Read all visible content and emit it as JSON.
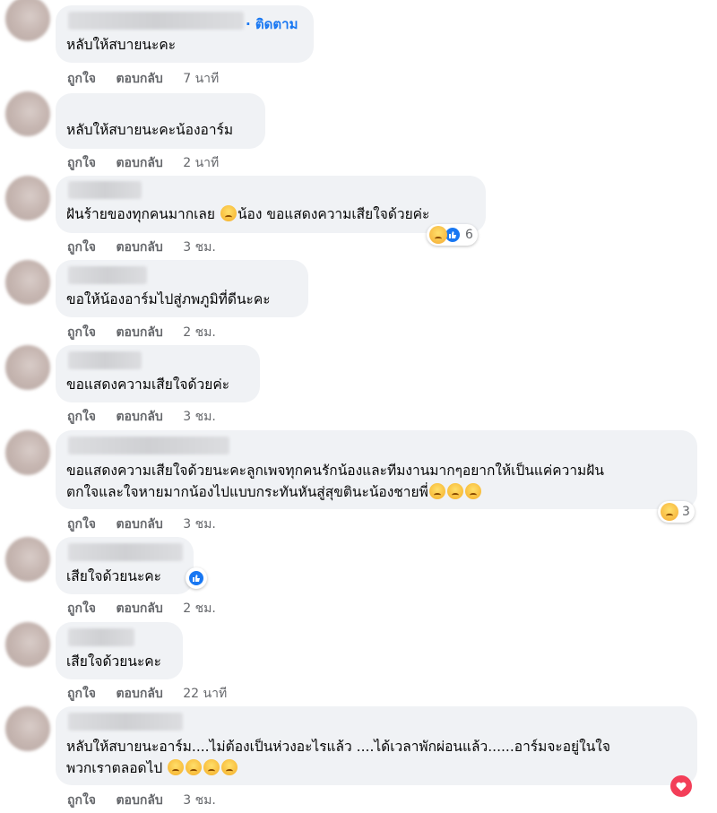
{
  "comments": [
    {
      "follow": "· ติดตาม",
      "text": [
        "หลับให้สบายนะคะ"
      ],
      "like": "ถูกใจ",
      "reply": "ตอบกลับ",
      "time": "7 นาที"
    },
    {
      "text": [
        "หลับให้สบายนะคะน้องอาร์ม"
      ],
      "like": "ถูกใจ",
      "reply": "ตอบกลับ",
      "time": "2 นาที"
    },
    {
      "text_before_emoji": "ฝันร้ายของทุกคนมากเลย",
      "text_after_emoji": "น้อง ขอแสดงความเสียใจด้วยค่ะ",
      "like": "ถูกใจ",
      "reply": "ตอบกลับ",
      "time": "3 ชม.",
      "reaction_count": "6"
    },
    {
      "text": [
        "ขอให้น้องอาร์มไปสู่ภพภูมิที่ดีนะคะ"
      ],
      "like": "ถูกใจ",
      "reply": "ตอบกลับ",
      "time": "2 ชม."
    },
    {
      "text": [
        "ขอแสดงความเสียใจด้วยค่ะ"
      ],
      "like": "ถูกใจ",
      "reply": "ตอบกลับ",
      "time": "3 ชม."
    },
    {
      "text": [
        "ขอแสดงความเสียใจด้วยนะคะลูกเพจทุกคนรักน้องและทีมงานมากๆอยากให้เป็นแค่ความฝัน",
        "ตกใจและใจหายมากน้องไปแบบกระทันหันสู่สุขตินะน้องชายพี่"
      ],
      "like": "ถูกใจ",
      "reply": "ตอบกลับ",
      "time": "3 ชม.",
      "reaction_count": "3"
    },
    {
      "text": [
        "เสียใจด้วยนะคะ"
      ],
      "like": "ถูกใจ",
      "reply": "ตอบกลับ",
      "time": "2 ชม."
    },
    {
      "text": [
        "เสียใจด้วยนะคะ"
      ],
      "like": "ถูกใจ",
      "reply": "ตอบกลับ",
      "time": "22 นาที"
    },
    {
      "text": [
        "หลับให้สบายนะอาร์ม....ไม่ต้องเป็นห่วงอะไรแล้ว ....ได้เวลาพักผ่อนแล้ว......อาร์มจะอยู่ในใจ",
        "พวกเราตลอดไป"
      ],
      "like": "ถูกใจ",
      "reply": "ตอบกลับ",
      "time": "3 ชม."
    }
  ],
  "icons": {
    "sad_reaction": "sad-face-icon",
    "like_reaction": "thumbs-up-icon",
    "love_reaction": "heart-icon",
    "crying_emoji": "crying-face-emoji"
  },
  "colors": {
    "bubble": "#f0f2f5",
    "link": "#1877f2",
    "meta": "#65676b",
    "like_blue": "#1877f2",
    "love_red": "#f33e58"
  }
}
